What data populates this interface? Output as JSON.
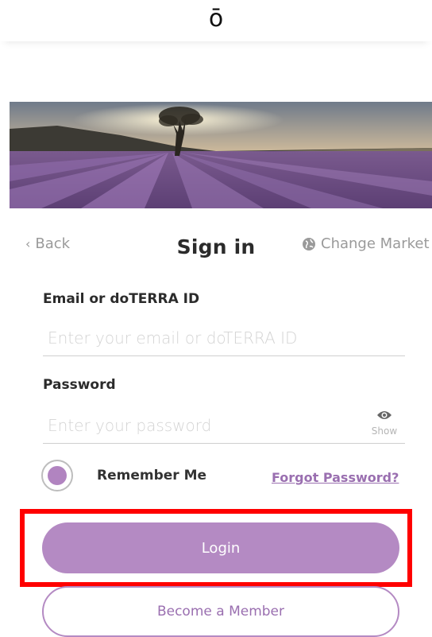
{
  "header": {
    "logo_text": "ō"
  },
  "nav": {
    "back_label": "Back",
    "title": "Sign in",
    "market_label": "Change Market"
  },
  "form": {
    "email_label": "Email or doTERRA ID",
    "email_placeholder": "Enter your email or doTERRA ID",
    "password_label": "Password",
    "password_placeholder": "Enter your password",
    "show_label": "Show",
    "remember_label": "Remember Me",
    "remember_checked": true,
    "forgot_label": "Forgot Password?"
  },
  "actions": {
    "login_label": "Login",
    "member_label": "Become a Member"
  },
  "colors": {
    "accent": "#b48ac3",
    "link": "#9a6fb0",
    "highlight": "#ff0000"
  },
  "icons": {
    "back": "chevron-left-icon",
    "market": "globe-icon",
    "show": "eye-icon"
  }
}
